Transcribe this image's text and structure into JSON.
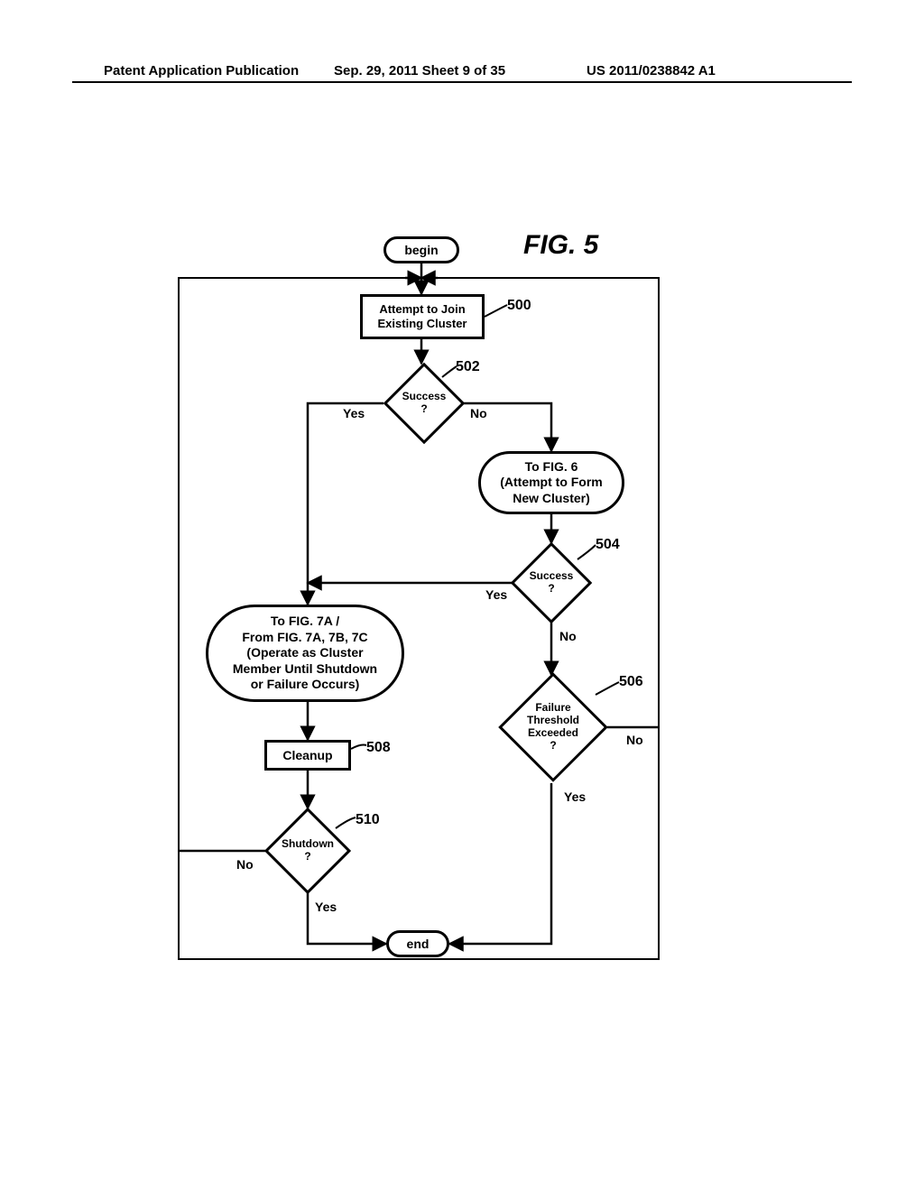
{
  "header": {
    "left": "Patent Application Publication",
    "center": "Sep. 29, 2011  Sheet 9 of 35",
    "right": "US 2011/0238842 A1"
  },
  "figure_title": "FIG. 5",
  "nodes": {
    "begin": "begin",
    "end": "end",
    "attempt_join": "Attempt to Join\nExisting Cluster",
    "success1": "Success\n?",
    "to_fig6": "To FIG. 6\n(Attempt to Form\nNew Cluster)",
    "success2": "Success\n?",
    "failure_threshold": "Failure\nThreshold\nExceeded\n?",
    "to_fig7": "To FIG. 7A /\nFrom FIG. 7A, 7B, 7C\n(Operate as Cluster\nMember Until Shutdown\nor Failure Occurs)",
    "cleanup": "Cleanup",
    "shutdown": "Shutdown\n?"
  },
  "refs": {
    "r500": "500",
    "r502": "502",
    "r504": "504",
    "r506": "506",
    "r508": "508",
    "r510": "510"
  },
  "edge_labels": {
    "yes": "Yes",
    "no": "No"
  },
  "chart_data": {
    "type": "flowchart",
    "title": "FIG. 5",
    "nodes": [
      {
        "id": "begin",
        "kind": "terminator",
        "label": "begin"
      },
      {
        "id": "n500",
        "kind": "process",
        "label": "Attempt to Join Existing Cluster",
        "ref": "500"
      },
      {
        "id": "n502",
        "kind": "decision",
        "label": "Success ?",
        "ref": "502"
      },
      {
        "id": "fig6",
        "kind": "offpage",
        "label": "To FIG. 6 (Attempt to Form New Cluster)"
      },
      {
        "id": "n504",
        "kind": "decision",
        "label": "Success ?",
        "ref": "504"
      },
      {
        "id": "n506",
        "kind": "decision",
        "label": "Failure Threshold Exceeded ?",
        "ref": "506"
      },
      {
        "id": "fig7",
        "kind": "offpage",
        "label": "To FIG. 7A / From FIG. 7A, 7B, 7C (Operate as Cluster Member Until Shutdown or Failure Occurs)"
      },
      {
        "id": "n508",
        "kind": "process",
        "label": "Cleanup",
        "ref": "508"
      },
      {
        "id": "n510",
        "kind": "decision",
        "label": "Shutdown ?",
        "ref": "510"
      },
      {
        "id": "end",
        "kind": "terminator",
        "label": "end"
      }
    ],
    "edges": [
      {
        "from": "begin",
        "to": "n500"
      },
      {
        "from": "n500",
        "to": "n502"
      },
      {
        "from": "n502",
        "to": "fig7",
        "label": "Yes"
      },
      {
        "from": "n502",
        "to": "fig6",
        "label": "No"
      },
      {
        "from": "fig6",
        "to": "n504"
      },
      {
        "from": "n504",
        "to": "fig7",
        "label": "Yes"
      },
      {
        "from": "n504",
        "to": "n506",
        "label": "No"
      },
      {
        "from": "n506",
        "to": "n500",
        "label": "No"
      },
      {
        "from": "n506",
        "to": "end",
        "label": "Yes"
      },
      {
        "from": "fig7",
        "to": "n508"
      },
      {
        "from": "n508",
        "to": "n510"
      },
      {
        "from": "n510",
        "to": "n500",
        "label": "No"
      },
      {
        "from": "n510",
        "to": "end",
        "label": "Yes"
      }
    ]
  }
}
